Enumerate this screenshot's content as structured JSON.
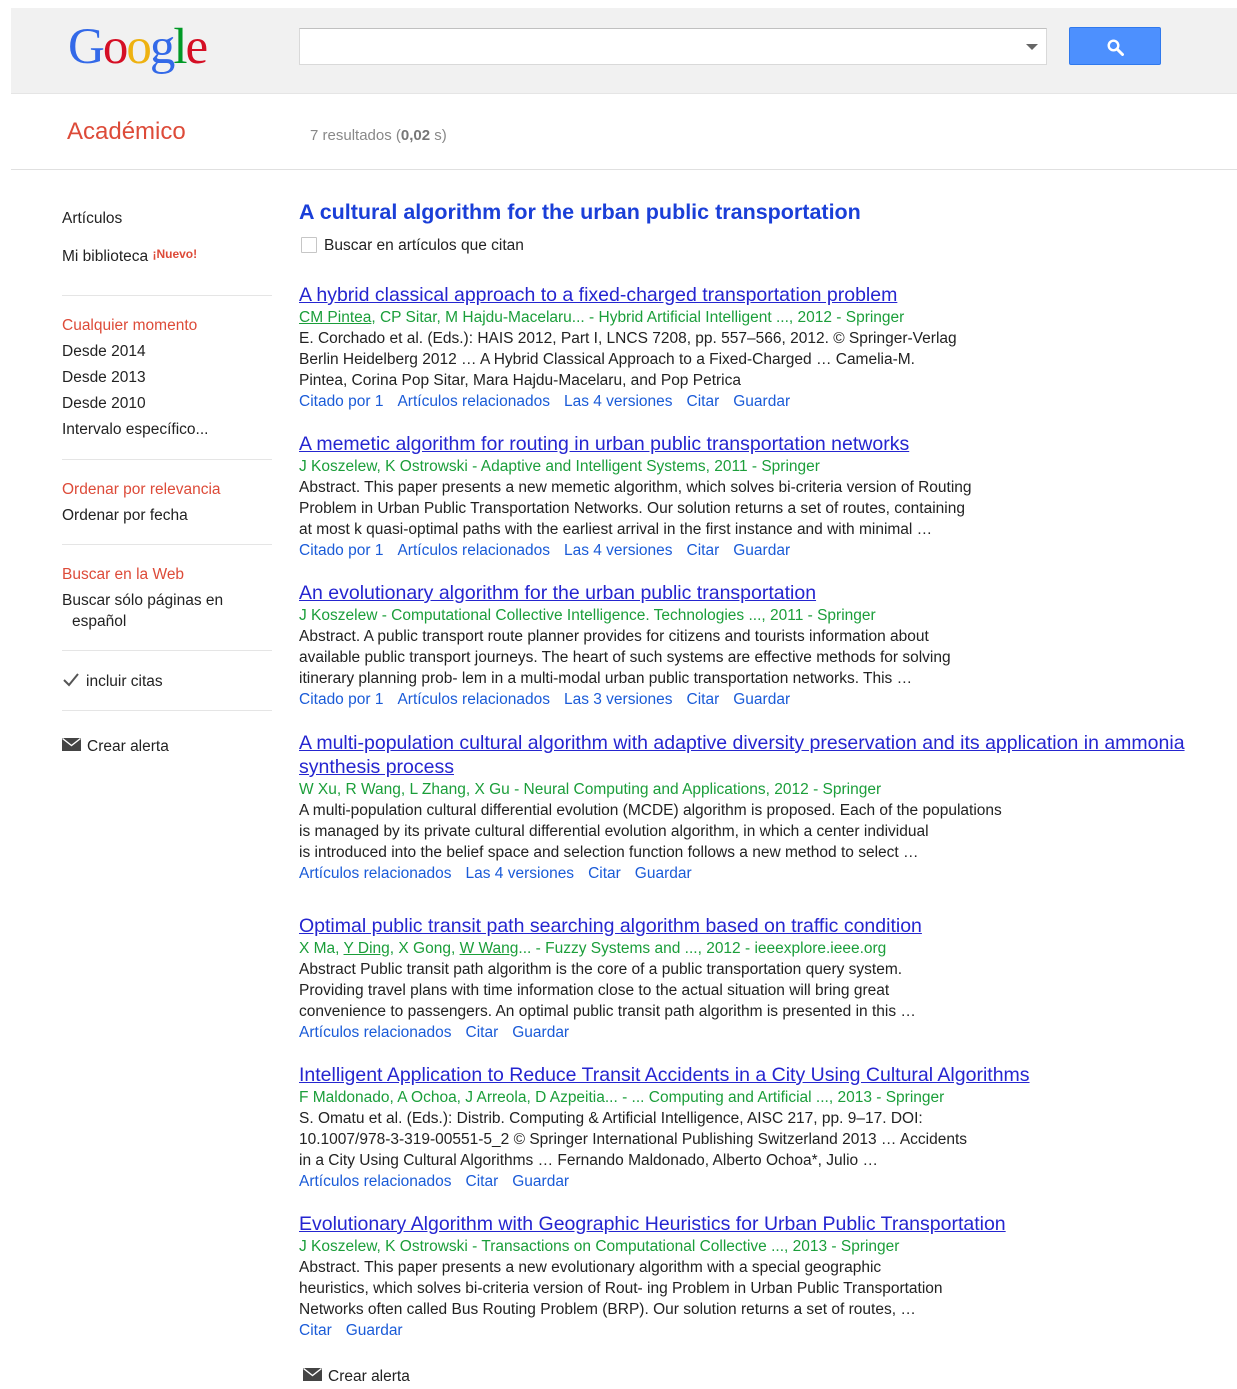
{
  "header": {
    "logo": [
      "G",
      "o",
      "o",
      "g",
      "l",
      "e"
    ],
    "search_value": "",
    "search_button_icon": "search-icon"
  },
  "subheader": {
    "title": "Académico",
    "results_prefix": "7 resultados (",
    "results_time": "0,02",
    "results_suffix": " s)"
  },
  "sidebar": {
    "articles": "Artículos",
    "library": "Mi biblioteca",
    "new_badge": "¡Nuevo!",
    "time_any": "Cualquier momento",
    "since_2014": "Desde 2014",
    "since_2013": "Desde 2013",
    "since_2010": "Desde 2010",
    "custom_range": "Intervalo específico...",
    "sort_relevance": "Ordenar por relevancia",
    "sort_date": "Ordenar por fecha",
    "search_web": "Buscar en la Web",
    "spanish_only_1": "Buscar sólo páginas en",
    "spanish_only_2": "español",
    "include_citations": "incluir citas",
    "create_alert": "Crear alerta"
  },
  "main": {
    "cited_title": "A cultural algorithm for the urban public transportation",
    "search_citing": "Buscar en artículos que citan",
    "results": [
      {
        "title": "A hybrid classical approach to a fixed-charged transportation problem",
        "authors_linked": [
          "CM Pintea"
        ],
        "authors_rest": ", CP Sitar, M Hajdu-Macelaru... - Hybrid Artificial Intelligent ..., 2012 - Springer",
        "snippet": [
          "E. Corchado et al. (Eds.): HAIS 2012, Part I, LNCS 7208, pp. 557–566, 2012. © Springer-Verlag",
          "Berlin Heidelberg 2012 … A Hybrid Classical Approach to a Fixed-Charged … Camelia-M.",
          "Pintea, Corina Pop Sitar, Mara Hajdu-Macelaru, and Pop Petrica"
        ],
        "actions": [
          "Citado por 1",
          "Artículos relacionados",
          "Las 4 versiones",
          "Citar",
          "Guardar"
        ]
      },
      {
        "title": "A memetic algorithm for routing in urban public transportation networks",
        "authors_linked": [],
        "authors_rest": "J Koszelew, K Ostrowski - Adaptive and Intelligent Systems, 2011 - Springer",
        "snippet": [
          "Abstract. This paper presents a new memetic algorithm, which solves bi-criteria version of Routing",
          "Problem in Urban Public Transportation Networks. Our solution returns a set of routes, containing",
          "at most k quasi-optimal paths with the earliest arrival in the first instance and with minimal …"
        ],
        "actions": [
          "Citado por 1",
          "Artículos relacionados",
          "Las 4 versiones",
          "Citar",
          "Guardar"
        ]
      },
      {
        "title": "An evolutionary algorithm for the urban public transportation",
        "authors_linked": [],
        "authors_rest": "J Koszelew - Computational Collective Intelligence. Technologies ..., 2011 - Springer",
        "snippet": [
          "Abstract. A public transport route planner provides for citizens and tourists information about",
          "available public transport journeys. The heart of such systems are effective methods for solving",
          "itinerary planning prob- lem in a multi-modal urban public transportation networks. This …"
        ],
        "actions": [
          "Citado por 1",
          "Artículos relacionados",
          "Las 3 versiones",
          "Citar",
          "Guardar"
        ]
      },
      {
        "title": "A multi-population cultural algorithm with adaptive diversity preservation and its application in ammonia synthesis process",
        "authors_linked": [],
        "authors_rest": "W Xu, R Wang, L Zhang, X Gu - Neural Computing and Applications, 2012 - Springer",
        "snippet": [
          "A multi-population cultural differential evolution (MCDE) algorithm is proposed. Each of the populations",
          "is managed by its private cultural differential evolution algorithm, in which a center individual",
          "is introduced into the belief space and selection function follows a new method to select …"
        ],
        "actions": [
          "Artículos relacionados",
          "Las 4 versiones",
          "Citar",
          "Guardar"
        ]
      },
      {
        "title": "Optimal public transit path searching algorithm based on traffic condition",
        "authors_pre": "X Ma, ",
        "authors_link1": "Y Ding",
        "authors_mid": ", X Gong, ",
        "authors_link2": "W Wang",
        "authors_rest": "... - Fuzzy Systems and ..., 2012 - ieeexplore.ieee.org",
        "snippet": [
          "Abstract Public transit path algorithm is the core of a public transportation query system.",
          "Providing travel plans with time information close to the actual situation will bring great",
          "convenience to passengers. An optimal public transit path algorithm is presented in this …"
        ],
        "actions": [
          "Artículos relacionados",
          "Citar",
          "Guardar"
        ]
      },
      {
        "title": "Intelligent Application to Reduce Transit Accidents in a City Using Cultural Algorithms",
        "authors_linked": [],
        "authors_rest": "F Maldonado, A Ochoa, J Arreola, D Azpeitia... - ... Computing and Artificial ..., 2013 - Springer",
        "snippet": [
          "S. Omatu et al. (Eds.): Distrib. Computing & Artificial Intelligence, AISC 217, pp. 9–17. DOI:",
          "10.1007/978-3-319-00551-5_2 © Springer International Publishing Switzerland 2013 … Accidents",
          "in a City Using Cultural Algorithms … Fernando Maldonado, Alberto Ochoa*, Julio …"
        ],
        "actions": [
          "Artículos relacionados",
          "Citar",
          "Guardar"
        ]
      },
      {
        "title": "Evolutionary Algorithm with Geographic Heuristics for Urban Public Transportation",
        "authors_linked": [],
        "authors_rest": "J Koszelew, K Ostrowski - Transactions on Computational Collective ..., 2013 - Springer",
        "snippet": [
          "Abstract. This paper presents a new evolutionary algorithm with a special geographic",
          "heuristics, which solves bi-criteria version of Rout- ing Problem in Urban Public Transportation",
          "Networks often called Bus Routing Problem (BRP). Our solution returns a set of routes, …"
        ],
        "actions": [
          "Citar",
          "Guardar"
        ]
      }
    ],
    "create_alert": "Crear alerta"
  },
  "colors": {
    "accent_red": "#dd4b39",
    "link_blue": "#2525d0",
    "author_green": "#1b9e3a",
    "button_blue": "#4d90fe"
  }
}
